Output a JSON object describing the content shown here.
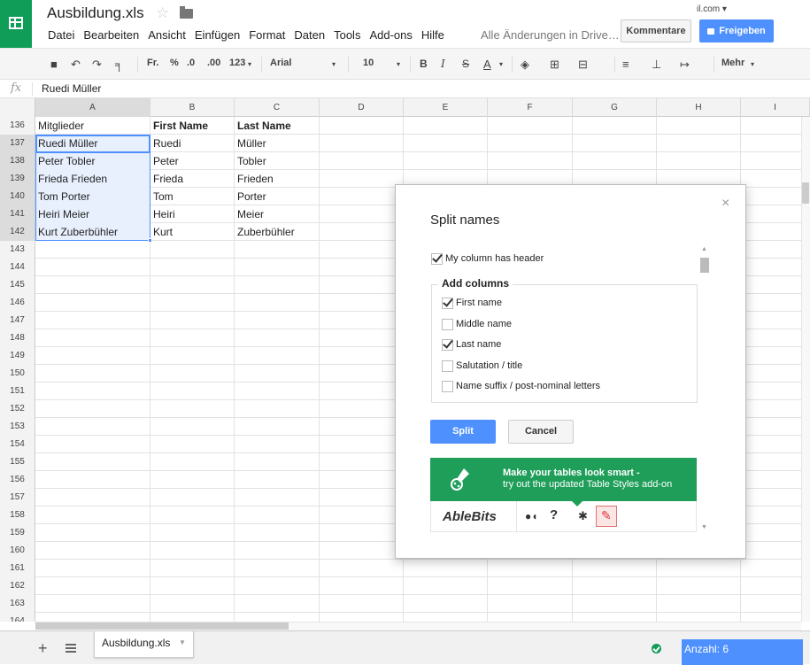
{
  "header": {
    "title": "Ausbildung.xls",
    "account": "il.com ▾",
    "menus": [
      "Datei",
      "Bearbeiten",
      "Ansicht",
      "Einfügen",
      "Format",
      "Daten",
      "Tools",
      "Add-ons",
      "Hilfe"
    ],
    "save_status": "Alle Änderungen in Drive…",
    "comment_label": "Kommentare",
    "share_label": "Freigeben"
  },
  "toolbar": {
    "currency": "Fr.",
    "percent": "%",
    "dec_less": ".0",
    "dec_more": ".00",
    "number_format": "123",
    "font": "Arial",
    "size": "10",
    "bold": "B",
    "italic": "I",
    "strike": "S",
    "text_color": "A",
    "more": "Mehr"
  },
  "formula_bar": {
    "fx": "fx",
    "content": "Ruedi Müller"
  },
  "columns": [
    "A",
    "B",
    "C",
    "D",
    "E",
    "F",
    "G",
    "H",
    "I"
  ],
  "rows": [
    {
      "n": "136",
      "a": "Mitglieder",
      "b": "First Name",
      "c": "Last Name"
    },
    {
      "n": "137",
      "a": "Ruedi Müller",
      "b": "Ruedi",
      "c": "Müller"
    },
    {
      "n": "138",
      "a": "Peter Tobler",
      "b": "Peter",
      "c": "Tobler"
    },
    {
      "n": "139",
      "a": "Frieda Frieden",
      "b": "Frieda",
      "c": "Frieden"
    },
    {
      "n": "140",
      "a": "Tom Porter",
      "b": "Tom",
      "c": "Porter"
    },
    {
      "n": "141",
      "a": "Heiri Meier",
      "b": "Heiri",
      "c": "Meier"
    },
    {
      "n": "142",
      "a": "Kurt Zuberbühler",
      "b": "Kurt",
      "c": "Zuberbühler"
    },
    {
      "n": "143",
      "a": "",
      "b": "",
      "c": ""
    },
    {
      "n": "144",
      "a": "",
      "b": "",
      "c": ""
    },
    {
      "n": "145",
      "a": "",
      "b": "",
      "c": ""
    },
    {
      "n": "146",
      "a": "",
      "b": "",
      "c": ""
    },
    {
      "n": "147",
      "a": "",
      "b": "",
      "c": ""
    },
    {
      "n": "148",
      "a": "",
      "b": "",
      "c": ""
    },
    {
      "n": "149",
      "a": "",
      "b": "",
      "c": ""
    },
    {
      "n": "150",
      "a": "",
      "b": "",
      "c": ""
    },
    {
      "n": "151",
      "a": "",
      "b": "",
      "c": ""
    },
    {
      "n": "152",
      "a": "",
      "b": "",
      "c": ""
    },
    {
      "n": "153",
      "a": "",
      "b": "",
      "c": ""
    },
    {
      "n": "154",
      "a": "",
      "b": "",
      "c": ""
    },
    {
      "n": "155",
      "a": "",
      "b": "",
      "c": ""
    },
    {
      "n": "156",
      "a": "",
      "b": "",
      "c": ""
    },
    {
      "n": "157",
      "a": "",
      "b": "",
      "c": ""
    },
    {
      "n": "158",
      "a": "",
      "b": "",
      "c": ""
    },
    {
      "n": "159",
      "a": "",
      "b": "",
      "c": ""
    },
    {
      "n": "160",
      "a": "",
      "b": "",
      "c": ""
    },
    {
      "n": "161",
      "a": "",
      "b": "",
      "c": ""
    },
    {
      "n": "162",
      "a": "",
      "b": "",
      "c": ""
    },
    {
      "n": "163",
      "a": "",
      "b": "",
      "c": ""
    },
    {
      "n": "164",
      "a": "",
      "b": "",
      "c": ""
    }
  ],
  "sheetbar": {
    "tab_label": "Ausbildung.xls",
    "count": "Anzahl: 6"
  },
  "dialog": {
    "close": "×",
    "title": "Split names",
    "header_checkbox": "My column has header",
    "columns_legend": "Add columns",
    "options": [
      {
        "label": "First name",
        "checked": true
      },
      {
        "label": "Middle name",
        "checked": false
      },
      {
        "label": "Last name",
        "checked": true
      },
      {
        "label": "Salutation / title",
        "checked": false
      },
      {
        "label": "Name suffix / post-nominal letters",
        "checked": false
      }
    ],
    "split_label": "Split",
    "cancel_label": "Cancel",
    "promo_line1": "Make your tables look smart -",
    "promo_line2": "try out the updated Table Styles add-on",
    "brand": "AbleBits"
  },
  "colors": {
    "accent": "#4d90fe",
    "sheets_green": "#0f9d58",
    "promo_green": "#1e9e59"
  }
}
